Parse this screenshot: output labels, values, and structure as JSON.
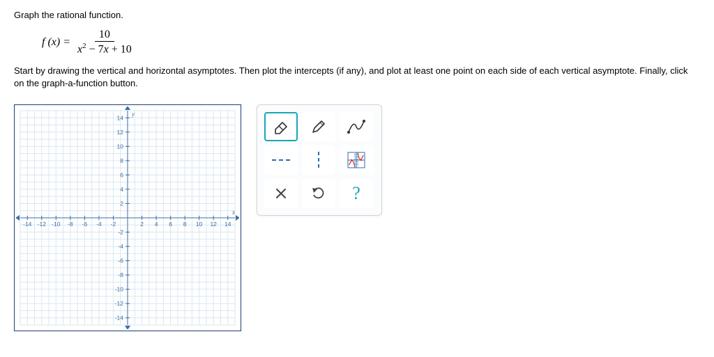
{
  "prompt": "Graph the rational function.",
  "equation": {
    "lhs": "f (x) =",
    "numerator": "10",
    "denominator": "x² − 7x + 10"
  },
  "instruction": "Start by drawing the vertical and horizontal asymptotes. Then plot the intercepts (if any), and plot at least one point on each side of each vertical asymptote. Finally, click on the graph-a-function button.",
  "graph": {
    "xmin": -15,
    "xmax": 15,
    "ymin": -15,
    "ymax": 15,
    "xaxis_label": "x",
    "yaxis_label": "y",
    "xticks": [
      -14,
      -12,
      -10,
      -8,
      -6,
      -4,
      -2,
      2,
      4,
      6,
      8,
      10,
      12,
      14
    ],
    "yticks": [
      -14,
      -12,
      -10,
      -8,
      -6,
      -4,
      -2,
      2,
      4,
      6,
      8,
      10,
      12,
      14
    ]
  },
  "tools": {
    "eraser": "eraser",
    "pencil": "pencil",
    "curve": "curve",
    "h_asymptote": "horizontal-asymptote",
    "v_asymptote": "vertical-asymptote",
    "graph_function": "graph-a-function",
    "delete": "delete",
    "undo": "undo",
    "help": "help"
  }
}
